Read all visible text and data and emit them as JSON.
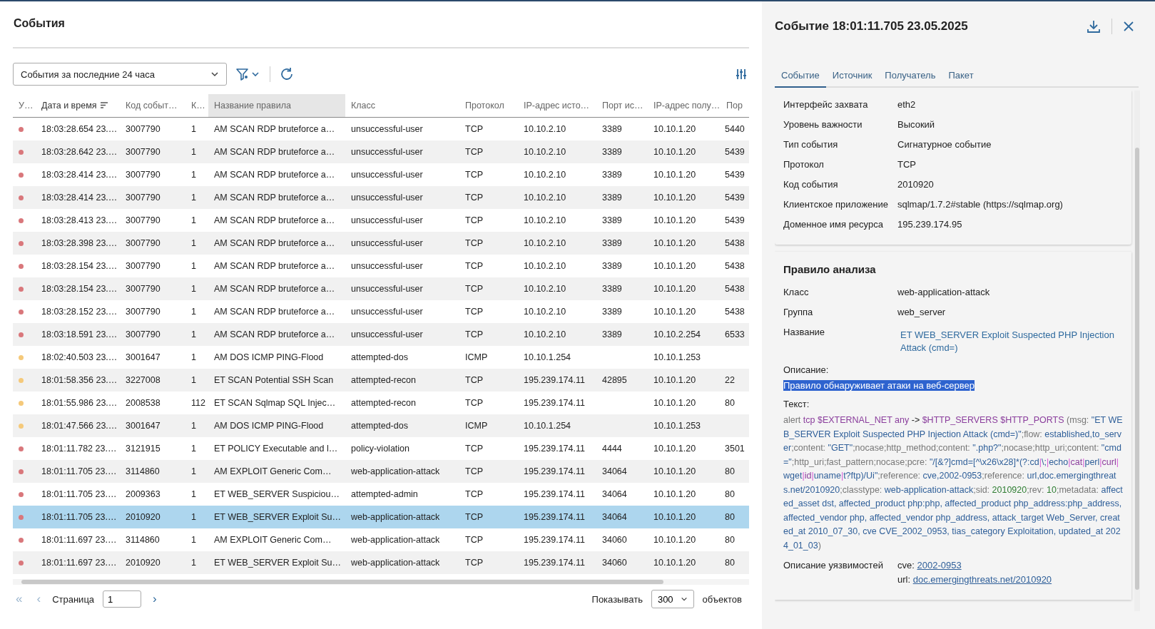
{
  "page": {
    "title": "События"
  },
  "toolbar": {
    "period": "События за последние 24 часа"
  },
  "table": {
    "columns": [
      {
        "label": "У…",
        "selected": false,
        "sorted": false
      },
      {
        "label": "Дата и время",
        "selected": false,
        "sorted": true
      },
      {
        "label": "Код событ…",
        "selected": false,
        "sorted": false
      },
      {
        "label": "К…",
        "selected": false,
        "sorted": false
      },
      {
        "label": "Название правила",
        "selected": true,
        "sorted": false
      },
      {
        "label": "Класс",
        "selected": false,
        "sorted": false
      },
      {
        "label": "Протокол",
        "selected": false,
        "sorted": false
      },
      {
        "label": "IP-адрес исто…",
        "selected": false,
        "sorted": false
      },
      {
        "label": "Порт ис…",
        "selected": false,
        "sorted": false
      },
      {
        "label": "IP-адрес полу…",
        "selected": false,
        "sorted": false
      },
      {
        "label": "Пор",
        "selected": false,
        "sorted": false
      }
    ],
    "rows": [
      {
        "color": "#d9777b",
        "time": "18:03:28.654 23.…",
        "code": "3007790",
        "count": "1",
        "rule": "AM SCAN RDP bruteforce a…",
        "class": "unsuccessful-user",
        "protocol": "TCP",
        "src_ip": "10.10.2.10",
        "src_port": "3389",
        "dst_ip": "10.10.1.20",
        "dst_port": "5440",
        "selected": false
      },
      {
        "color": "#d9777b",
        "time": "18:03:28.642 23.…",
        "code": "3007790",
        "count": "1",
        "rule": "AM SCAN RDP bruteforce a…",
        "class": "unsuccessful-user",
        "protocol": "TCP",
        "src_ip": "10.10.2.10",
        "src_port": "3389",
        "dst_ip": "10.10.1.20",
        "dst_port": "5439",
        "selected": false
      },
      {
        "color": "#d9777b",
        "time": "18:03:28.414 23.…",
        "code": "3007790",
        "count": "1",
        "rule": "AM SCAN RDP bruteforce a…",
        "class": "unsuccessful-user",
        "protocol": "TCP",
        "src_ip": "10.10.2.10",
        "src_port": "3389",
        "dst_ip": "10.10.1.20",
        "dst_port": "5439",
        "selected": false
      },
      {
        "color": "#d9777b",
        "time": "18:03:28.414 23.…",
        "code": "3007790",
        "count": "1",
        "rule": "AM SCAN RDP bruteforce a…",
        "class": "unsuccessful-user",
        "protocol": "TCP",
        "src_ip": "10.10.2.10",
        "src_port": "3389",
        "dst_ip": "10.10.1.20",
        "dst_port": "5439",
        "selected": false
      },
      {
        "color": "#d9777b",
        "time": "18:03:28.413 23.…",
        "code": "3007790",
        "count": "1",
        "rule": "AM SCAN RDP bruteforce a…",
        "class": "unsuccessful-user",
        "protocol": "TCP",
        "src_ip": "10.10.2.10",
        "src_port": "3389",
        "dst_ip": "10.10.1.20",
        "dst_port": "5439",
        "selected": false
      },
      {
        "color": "#d9777b",
        "time": "18:03:28.398 23.…",
        "code": "3007790",
        "count": "1",
        "rule": "AM SCAN RDP bruteforce a…",
        "class": "unsuccessful-user",
        "protocol": "TCP",
        "src_ip": "10.10.2.10",
        "src_port": "3389",
        "dst_ip": "10.10.1.20",
        "dst_port": "5438",
        "selected": false
      },
      {
        "color": "#d9777b",
        "time": "18:03:28.154 23.…",
        "code": "3007790",
        "count": "1",
        "rule": "AM SCAN RDP bruteforce a…",
        "class": "unsuccessful-user",
        "protocol": "TCP",
        "src_ip": "10.10.2.10",
        "src_port": "3389",
        "dst_ip": "10.10.1.20",
        "dst_port": "5438",
        "selected": false
      },
      {
        "color": "#d9777b",
        "time": "18:03:28.154 23.…",
        "code": "3007790",
        "count": "1",
        "rule": "AM SCAN RDP bruteforce a…",
        "class": "unsuccessful-user",
        "protocol": "TCP",
        "src_ip": "10.10.2.10",
        "src_port": "3389",
        "dst_ip": "10.10.1.20",
        "dst_port": "5438",
        "selected": false
      },
      {
        "color": "#d9777b",
        "time": "18:03:28.152 23.…",
        "code": "3007790",
        "count": "1",
        "rule": "AM SCAN RDP bruteforce a…",
        "class": "unsuccessful-user",
        "protocol": "TCP",
        "src_ip": "10.10.2.10",
        "src_port": "3389",
        "dst_ip": "10.10.1.20",
        "dst_port": "5438",
        "selected": false
      },
      {
        "color": "#d9777b",
        "time": "18:03:18.591 23.…",
        "code": "3007790",
        "count": "1",
        "rule": "AM SCAN RDP bruteforce a…",
        "class": "unsuccessful-user",
        "protocol": "TCP",
        "src_ip": "10.10.2.10",
        "src_port": "3389",
        "dst_ip": "10.10.2.254",
        "dst_port": "6533",
        "selected": false
      },
      {
        "color": "#f5c97a",
        "time": "18:02:40.503 23.…",
        "code": "3001647",
        "count": "1",
        "rule": "AM DOS ICMP PING-Flood",
        "class": "attempted-dos",
        "protocol": "ICMP",
        "src_ip": "10.10.1.254",
        "dst_ip": "10.10.1.253",
        "selected": false
      },
      {
        "color": "#f5c97a",
        "time": "18:01:58.356 23.…",
        "code": "3227008",
        "count": "1",
        "rule": "ET SCAN Potential SSH Scan",
        "class": "attempted-recon",
        "protocol": "TCP",
        "src_ip": "195.239.174.11",
        "src_port": "42895",
        "dst_ip": "10.10.1.20",
        "dst_port": "22",
        "selected": false
      },
      {
        "color": "#f5c97a",
        "time": "18:01:55.986 23.…",
        "code": "2008538",
        "count": "112",
        "rule": "ET SCAN Sqlmap SQL Injec…",
        "class": "attempted-recon",
        "protocol": "TCP",
        "src_ip": "195.239.174.11",
        "dst_ip": "10.10.1.20",
        "dst_port": "80",
        "selected": false
      },
      {
        "color": "#f5c97a",
        "time": "18:01:47.566 23.…",
        "code": "3001647",
        "count": "1",
        "rule": "AM DOS ICMP PING-Flood",
        "class": "attempted-dos",
        "protocol": "ICMP",
        "src_ip": "10.10.1.254",
        "dst_ip": "10.10.1.253",
        "selected": false
      },
      {
        "color": "#d9777b",
        "time": "18:01:11.782 23.…",
        "code": "3121915",
        "count": "1",
        "rule": "ET POLICY Executable and l…",
        "class": "policy-violation",
        "protocol": "TCP",
        "src_ip": "195.239.174.11",
        "src_port": "4444",
        "dst_ip": "10.10.1.20",
        "dst_port": "3501",
        "selected": false
      },
      {
        "color": "#d9777b",
        "time": "18:01:11.705 23.…",
        "code": "3114860",
        "count": "1",
        "rule": "AM EXPLOIT Generic Com…",
        "class": "web-application-attack",
        "protocol": "TCP",
        "src_ip": "195.239.174.11",
        "src_port": "34064",
        "dst_ip": "10.10.1.20",
        "dst_port": "80",
        "selected": false
      },
      {
        "color": "#d9777b",
        "time": "18:01:11.705 23.…",
        "code": "2009363",
        "count": "1",
        "rule": "ET WEB_SERVER Suspiciou…",
        "class": "attempted-admin",
        "protocol": "TCP",
        "src_ip": "195.239.174.11",
        "src_port": "34064",
        "dst_ip": "10.10.1.20",
        "dst_port": "80",
        "selected": false
      },
      {
        "color": "#d9777b",
        "time": "18:01:11.705 23.…",
        "code": "2010920",
        "count": "1",
        "rule": "ET WEB_SERVER Exploit Su…",
        "class": "web-application-attack",
        "protocol": "TCP",
        "src_ip": "195.239.174.11",
        "src_port": "34064",
        "dst_ip": "10.10.1.20",
        "dst_port": "80",
        "selected": true
      },
      {
        "color": "#d9777b",
        "time": "18:01:11.697 23.…",
        "code": "3114860",
        "count": "1",
        "rule": "AM EXPLOIT Generic Com…",
        "class": "web-application-attack",
        "protocol": "TCP",
        "src_ip": "195.239.174.11",
        "src_port": "34060",
        "dst_ip": "10.10.1.20",
        "dst_port": "80",
        "selected": false
      },
      {
        "color": "#d9777b",
        "time": "18:01:11.697 23.…",
        "code": "2010920",
        "count": "1",
        "rule": "ET WEB_SERVER Exploit Su…",
        "class": "web-application-attack",
        "protocol": "TCP",
        "src_ip": "195.239.174.11",
        "src_port": "34060",
        "dst_ip": "10.10.1.20",
        "dst_port": "80",
        "selected": false
      }
    ]
  },
  "pagination": {
    "first": "«",
    "previous": "‹",
    "next": "›",
    "page_label": "Страница",
    "page": "1",
    "show_label": "Показывать",
    "page_size": "300",
    "objects_label": "объектов"
  },
  "details": {
    "title": "Событие 18:01:11.705 23.05.2025",
    "tabs": [
      {
        "label": "Событие",
        "selected": true
      },
      {
        "label": "Источник",
        "selected": false
      },
      {
        "label": "Получатель",
        "selected": false
      },
      {
        "label": "Пакет",
        "selected": false
      }
    ],
    "fields": [
      {
        "label": "Интерфейс захвата",
        "value": "eth2"
      },
      {
        "label": "Уровень важности",
        "value": "Высокий"
      },
      {
        "label": "Тип события",
        "value": "Сигнатурное событие"
      },
      {
        "label": "Протокол",
        "value": "TCP"
      },
      {
        "label": "Код события",
        "value": "2010920"
      },
      {
        "label": "Клиентское приложение",
        "value": "sqlmap/1.7.2#stable (https://sqlmap.org)"
      },
      {
        "label": "Доменное имя ресурса",
        "value": "195.239.174.95"
      }
    ],
    "rule": {
      "title": "Правило анализа",
      "fields": [
        {
          "label": "Класс",
          "value": "web-application-attack",
          "kind": "text"
        },
        {
          "label": "Группа",
          "value": "web_server",
          "kind": "text"
        },
        {
          "label": "Название",
          "value": "ET WEB_SERVER Exploit Suspected PHP Injection Attack (cmd=)",
          "kind": "link"
        }
      ],
      "description_label": "Описание:",
      "description": {
        "text": "Правило обнаруживает атаки на веб-сервер",
        "selected": true
      },
      "text_label": "Текст:",
      "text": [
        {
          "kind": "plain",
          "text": "alert "
        },
        {
          "kind": "keyword",
          "text": "tcp $EXTERNAL_NET any"
        },
        {
          "kind": "op",
          "text": " -> "
        },
        {
          "kind": "keyword",
          "text": "$HTTP_SERVERS $HTTP_PORTS"
        },
        {
          "kind": "plain",
          "text": " (msg: "
        },
        {
          "kind": "string",
          "text": "\"ET WEB_SERVER Exploit Suspected PHP Injection Attack (cmd=)\""
        },
        {
          "kind": "plain",
          "text": ";flow: "
        },
        {
          "kind": "string",
          "text": "established,to_server"
        },
        {
          "kind": "plain",
          "text": ";content: "
        },
        {
          "kind": "string",
          "text": "\"GET\""
        },
        {
          "kind": "plain",
          "text": ";nocase;http_method;content: "
        },
        {
          "kind": "string",
          "text": "\".php?\""
        },
        {
          "kind": "plain",
          "text": ";nocase;http_uri;content: "
        },
        {
          "kind": "string",
          "text": "\"cmd=\""
        },
        {
          "kind": "plain",
          "text": ";http_uri;fast_pattern;nocase;pcre: "
        },
        {
          "kind": "string",
          "text": "\"/[&?]cmd=[^\\x26\\x28]*(?:cd"
        },
        {
          "kind": "pipe",
          "text": "|"
        },
        {
          "kind": "string",
          "text": "\\;"
        },
        {
          "kind": "pipe",
          "text": "|"
        },
        {
          "kind": "string",
          "text": "echo"
        },
        {
          "kind": "pipe",
          "text": "|"
        },
        {
          "kind": "keyword",
          "text": "cat"
        },
        {
          "kind": "pipe",
          "text": "|"
        },
        {
          "kind": "string",
          "text": "perl"
        },
        {
          "kind": "pipe",
          "text": "|"
        },
        {
          "kind": "keyword",
          "text": "curl"
        },
        {
          "kind": "pipe",
          "text": "|"
        },
        {
          "kind": "string",
          "text": "wget"
        },
        {
          "kind": "pipe",
          "text": "|"
        },
        {
          "kind": "keyword",
          "text": "id"
        },
        {
          "kind": "pipe",
          "text": "|"
        },
        {
          "kind": "string",
          "text": "uname"
        },
        {
          "kind": "pipe",
          "text": "|"
        },
        {
          "kind": "string",
          "text": "t?ftp)/Ui\""
        },
        {
          "kind": "plain",
          "text": ";reference: "
        },
        {
          "kind": "string",
          "text": "cve,2002-0953"
        },
        {
          "kind": "plain",
          "text": ";reference: "
        },
        {
          "kind": "string",
          "text": "url,doc.emergingthreats.net/2010920"
        },
        {
          "kind": "plain",
          "text": ";classtype: "
        },
        {
          "kind": "string",
          "text": "web-application-attack"
        },
        {
          "kind": "plain",
          "text": ";sid: "
        },
        {
          "kind": "number",
          "text": "2010920"
        },
        {
          "kind": "plain",
          "text": ";rev: "
        },
        {
          "kind": "number",
          "text": "10"
        },
        {
          "kind": "plain",
          "text": ";metadata: "
        },
        {
          "kind": "string",
          "text": "affected_asset dst, affected_product php:php, affected_product php_address:php_address, affected_vendor php, affected_vendor php_address, attack_target Web_Server, created_at 2010_07_30, cve CVE_2002_0953, tias_category Exploitation, updated_at 2024_01_03"
        },
        {
          "kind": "plain",
          "text": ")"
        }
      ],
      "vuln_label": "Описание уязвимостей",
      "vulns": [
        {
          "prefix": "cve:",
          "link": "2002-0953"
        },
        {
          "prefix": "url:",
          "link": "doc.emergingthreats.net/2010920"
        }
      ]
    }
  }
}
